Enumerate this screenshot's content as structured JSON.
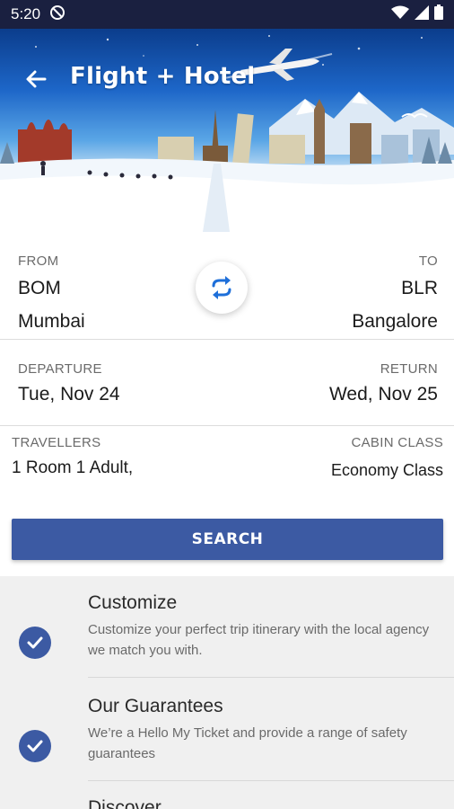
{
  "status_bar": {
    "time": "5:20",
    "icons": [
      "do-not-disturb-icon",
      "wifi-icon",
      "signal-icon",
      "battery-icon"
    ]
  },
  "header": {
    "title": "Flight + Hotel",
    "back_icon": "arrow-left-icon"
  },
  "route": {
    "from_label": "FROM",
    "from_code": "BOM",
    "from_city": "Mumbai",
    "to_label": "TO",
    "to_code": "BLR",
    "to_city": "Bangalore",
    "swap_icon": "swap-arrows-icon"
  },
  "dates": {
    "departure_label": "DEPARTURE",
    "departure_value": "Tue, Nov 24",
    "return_label": "RETURN",
    "return_value": "Wed, Nov 25"
  },
  "travel": {
    "travellers_label": "TRAVELLERS",
    "travellers_value": "1 Room 1 Adult,",
    "cabin_label": "CABIN CLASS",
    "cabin_value": "Economy Class"
  },
  "search_button": "SEARCH",
  "features": [
    {
      "title": "Customize",
      "description": "Customize your perfect trip itinerary with the local agency we match you with."
    },
    {
      "title": "Our Guarantees",
      "description": "We’re a Hello My Ticket and provide a range of safety guarantees"
    },
    {
      "title": "Discover",
      "description": ""
    }
  ],
  "colors": {
    "status_bar": "#1a2040",
    "accent": "#3c5aa3",
    "swap_icon": "#1e6fd9"
  }
}
